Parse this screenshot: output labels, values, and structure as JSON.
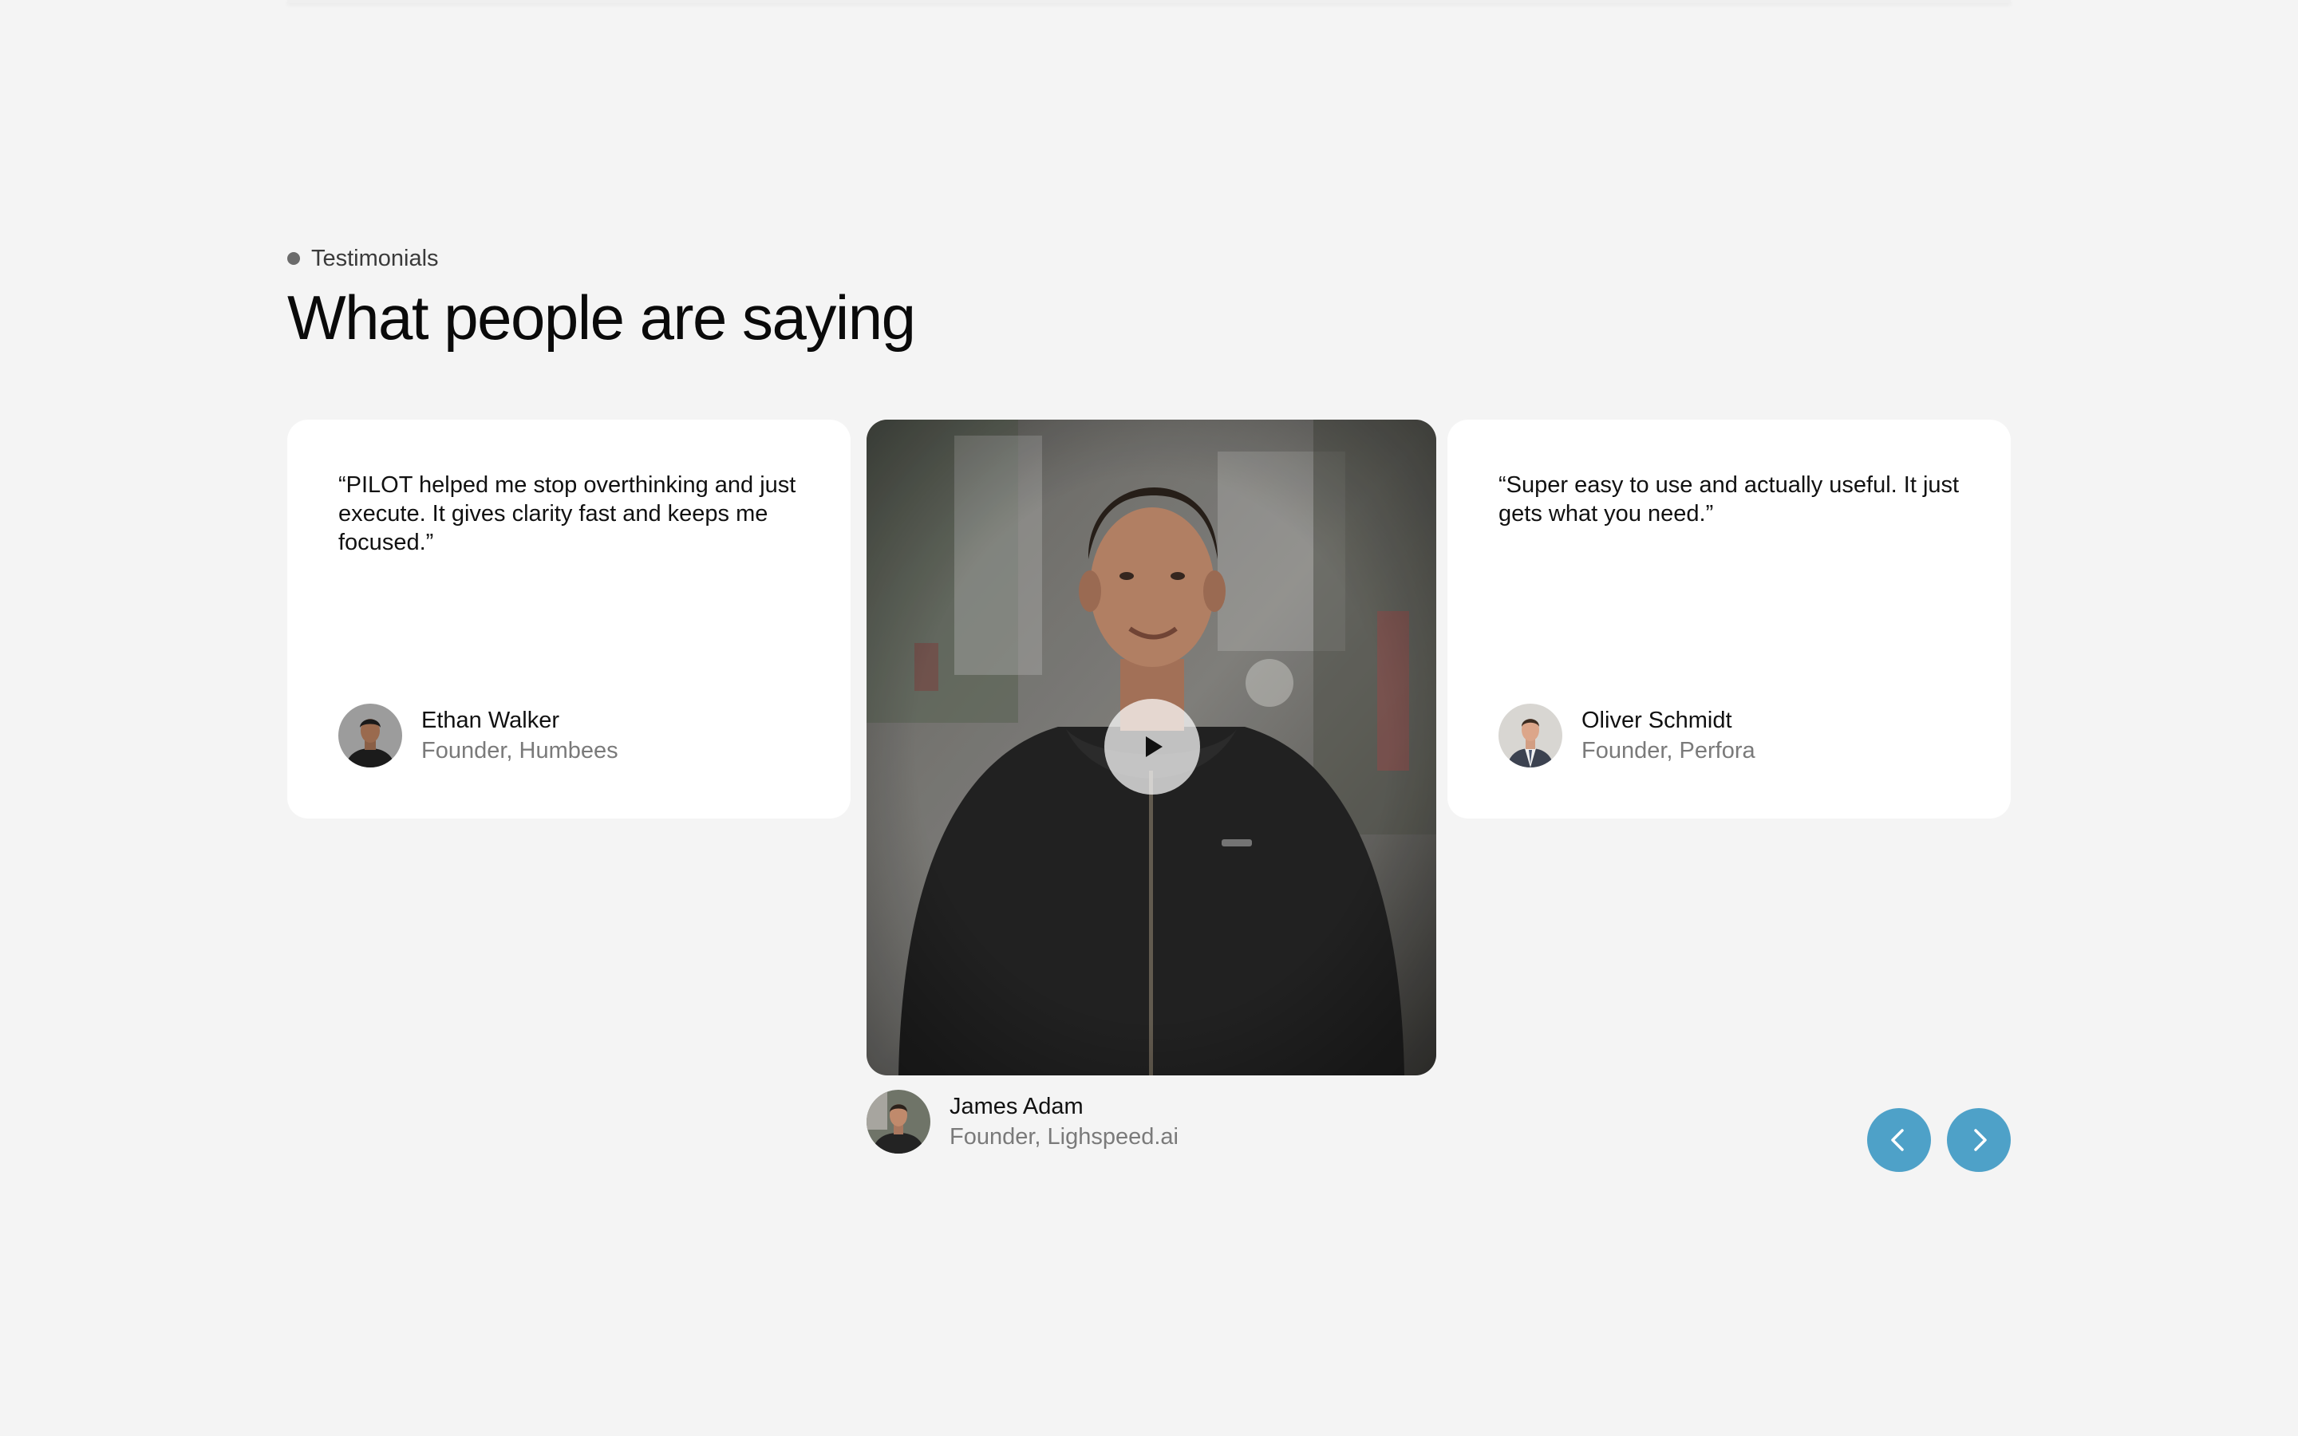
{
  "section": {
    "eyebrow": "Testimonials",
    "title": "What people are saying"
  },
  "testimonials": [
    {
      "quote": "“PILOT helped me stop overthinking and just execute. It gives clarity fast and keeps me focused.”",
      "name": "Ethan Walker",
      "role": "Founder, Humbees"
    },
    {
      "type": "video",
      "name": "James Adam",
      "role": "Founder, Lighspeed.ai"
    },
    {
      "quote": "“Super easy to use and actually useful. It just gets what you need.”",
      "name": "Oliver Schmidt",
      "role": "Founder, Perfora"
    }
  ],
  "icons": {
    "play": "play-icon",
    "prev": "chevron-left-icon",
    "next": "chevron-right-icon"
  },
  "colors": {
    "background": "#f4f4f4",
    "card": "#ffffff",
    "accent": "#4ea1c8",
    "muted_text": "#7a7a7a"
  }
}
